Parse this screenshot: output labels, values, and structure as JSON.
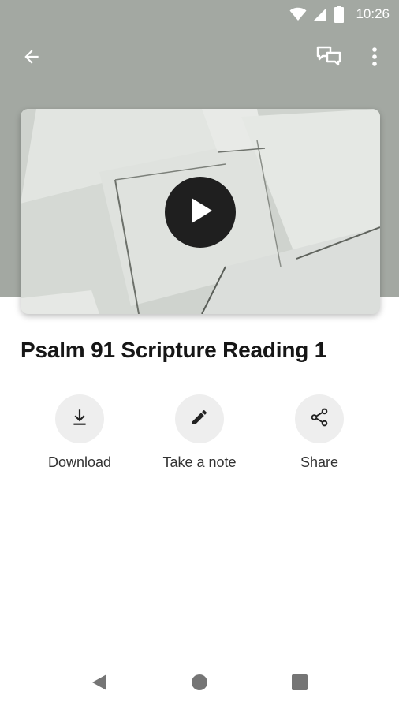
{
  "status_bar": {
    "time": "10:26",
    "icons": [
      "wifi-icon",
      "cellular-signal-icon",
      "battery-icon"
    ]
  },
  "app_bar": {
    "icons": [
      "back-arrow-icon",
      "chat-bubbles-icon",
      "more-vertical-icon"
    ]
  },
  "media": {
    "play_icon": "play-icon"
  },
  "title": "Psalm 91 Scripture Reading 1",
  "actions": [
    {
      "label": "Download",
      "icon": "download-icon"
    },
    {
      "label": "Take a note",
      "icon": "pencil-icon"
    },
    {
      "label": "Share",
      "icon": "share-icon"
    }
  ],
  "nav_bar": {
    "icons": [
      "nav-back-icon",
      "nav-home-icon",
      "nav-recents-icon"
    ]
  },
  "colors": {
    "header_background": "#a3a8a2",
    "play_button": "#1f1f1f",
    "action_circle": "#eeeeee",
    "title_text": "#161616"
  }
}
